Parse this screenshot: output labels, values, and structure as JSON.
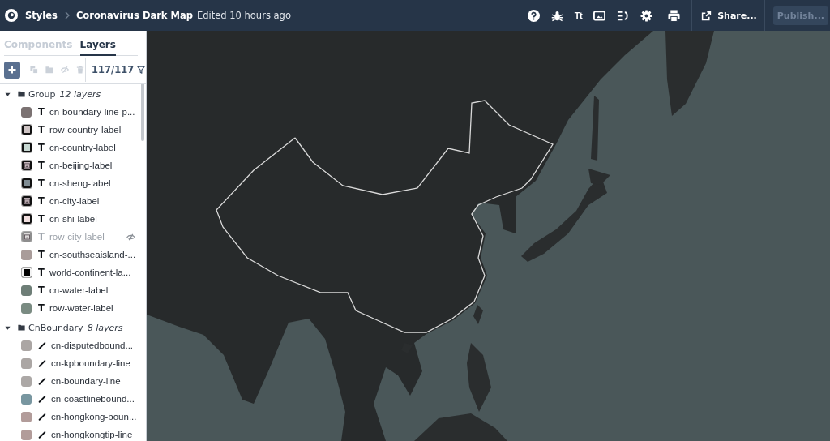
{
  "top_bar": {
    "breadcrumb": {
      "parent": "Styles",
      "title": "Coronavirus Dark Map",
      "status": "Edited 10 hours ago"
    },
    "tools": [
      {
        "kind": "help"
      },
      {
        "kind": "debug"
      },
      {
        "kind": "fonts",
        "glyph": "Tt"
      },
      {
        "kind": "images"
      },
      {
        "kind": "legend"
      },
      {
        "kind": "settings"
      },
      {
        "kind": "print"
      }
    ],
    "share": "Share...",
    "publish": {
      "label": "Publish...",
      "disabled": true
    }
  },
  "sidebar": {
    "tabs": [
      {
        "label": "Components",
        "selected": false
      },
      {
        "label": "Layers",
        "selected": true
      }
    ],
    "toolbar": {
      "actions": [
        {
          "kind": "add",
          "disabled": false
        },
        {
          "kind": "duplicate",
          "disabled": true
        },
        {
          "kind": "group",
          "disabled": true
        },
        {
          "kind": "hide",
          "disabled": true
        },
        {
          "kind": "delete",
          "disabled": true
        }
      ],
      "count": "117/117"
    },
    "groups": [
      {
        "name": "Group",
        "count": "12 layers",
        "expanded": true,
        "children": [
          {
            "name": "cn-boundary-line-p...",
            "kind": "symbol",
            "glyph": "T",
            "color": "#7b7272",
            "image": false,
            "hidden": false
          },
          {
            "name": "row-country-label",
            "kind": "symbol",
            "glyph": "T",
            "color": "#cdc3c3",
            "halo": {
              "color": "#111111"
            },
            "image": false,
            "hidden": false
          },
          {
            "name": "cn-country-label",
            "kind": "symbol",
            "glyph": "T",
            "color": "#c7d8d2",
            "halo": {
              "color": "#111111"
            },
            "image": false,
            "hidden": false
          },
          {
            "name": "cn-beijing-label",
            "kind": "symbol",
            "glyph": "T",
            "color": "#c9b9bf",
            "halo": {
              "color": "#111111"
            },
            "image": true,
            "hidden": false
          },
          {
            "name": "cn-sheng-label",
            "kind": "symbol",
            "glyph": "T",
            "color": "#7f8c93",
            "halo": {
              "color": "#111111"
            },
            "image": false,
            "hidden": false
          },
          {
            "name": "cn-city-label",
            "kind": "symbol",
            "glyph": "T",
            "color": "#b7a8ae",
            "halo": {
              "color": "#111111"
            },
            "image": true,
            "hidden": false
          },
          {
            "name": "cn-shi-label",
            "kind": "symbol",
            "glyph": "T",
            "color": "#f0dede",
            "halo": {
              "color": "#111111"
            },
            "image": false,
            "hidden": false
          },
          {
            "name": "row-city-label",
            "kind": "symbol",
            "glyph": "T",
            "color": "#dddada",
            "halo": {
              "color": "#8e8e8e"
            },
            "image": true,
            "hidden": true
          },
          {
            "name": "cn-southseaisland-...",
            "kind": "symbol",
            "glyph": "T",
            "color": "#a99c9a",
            "image": false,
            "hidden": false
          },
          {
            "name": "world-continent-la...",
            "kind": "symbol",
            "glyph": "T",
            "color": "#000000",
            "halo": {
              "color": "#f4f4f4"
            },
            "image": false,
            "hidden": false
          },
          {
            "name": "cn-water-label",
            "kind": "symbol",
            "glyph": "T",
            "color": "#6e7e77",
            "image": false,
            "hidden": false
          },
          {
            "name": "row-water-label",
            "kind": "symbol",
            "glyph": "T",
            "color": "#7a8b82",
            "image": false,
            "hidden": false
          }
        ]
      },
      {
        "name": "CnBoundary",
        "count": "8 layers",
        "expanded": true,
        "children": [
          {
            "name": "cn-disputedbound...",
            "kind": "line",
            "color": "#aba6a4",
            "image": false,
            "hidden": false
          },
          {
            "name": "cn-kpboundary-line",
            "kind": "line",
            "color": "#aba6a4",
            "image": false,
            "hidden": false
          },
          {
            "name": "cn-boundary-line",
            "kind": "line",
            "color": "#aca8a6",
            "image": false,
            "hidden": false
          },
          {
            "name": "cn-coastlinebound...",
            "kind": "line",
            "color": "#7896a0",
            "image": false,
            "hidden": false
          },
          {
            "name": "cn-hongkong-boun...",
            "kind": "line",
            "color": "#b29c9a",
            "image": false,
            "hidden": false
          },
          {
            "name": "cn-hongkongtip-line",
            "kind": "line",
            "color": "#b29c9a",
            "image": false,
            "hidden": false
          }
        ]
      }
    ]
  }
}
